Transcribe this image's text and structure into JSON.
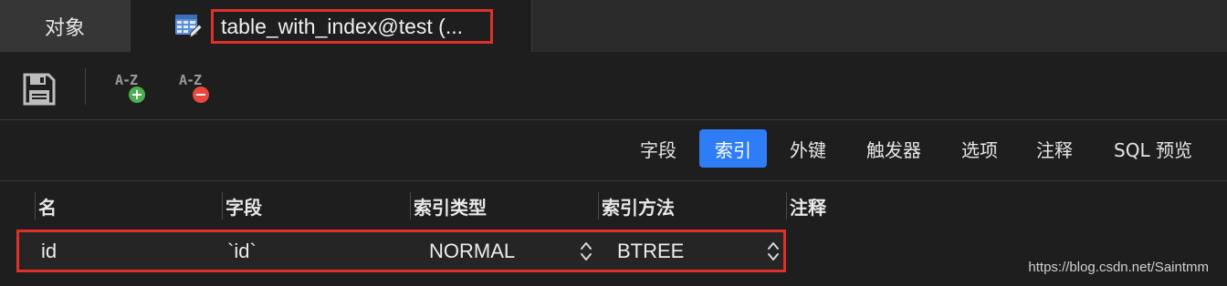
{
  "tabs": {
    "objects_label": "对象",
    "table_tab_label": "table_with_index@test (..."
  },
  "toolbar": {
    "save_icon": "floppy-disk-icon",
    "add_index_label": "A-Z",
    "add_index_badge": "+",
    "remove_index_label": "A-Z",
    "remove_index_badge": "−",
    "colors": {
      "add_badge": "#4caf50",
      "remove_badge": "#e8483e"
    }
  },
  "subtabs": [
    {
      "label": "字段",
      "active": false
    },
    {
      "label": "索引",
      "active": true
    },
    {
      "label": "外键",
      "active": false
    },
    {
      "label": "触发器",
      "active": false
    },
    {
      "label": "选项",
      "active": false
    },
    {
      "label": "注释",
      "active": false
    },
    {
      "label": "SQL 预览",
      "active": false
    }
  ],
  "grid": {
    "columns": [
      "名",
      "字段",
      "索引类型",
      "索引方法",
      "注释"
    ],
    "rows": [
      {
        "name": "id",
        "field": "`id`",
        "index_type": "NORMAL",
        "index_method": "BTREE",
        "comment": ""
      }
    ]
  },
  "watermark": "https://blog.csdn.net/Saintmm",
  "colors": {
    "accent": "#2f7df6",
    "highlight": "#e0302a",
    "background": "#1e1e1e"
  }
}
